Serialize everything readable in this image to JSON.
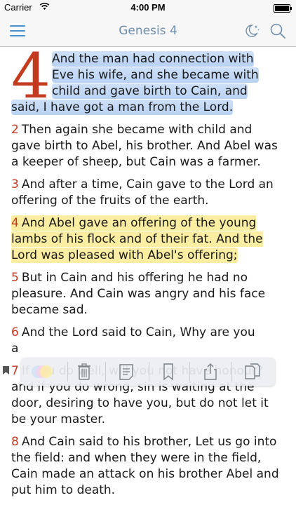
{
  "status_bar": {
    "carrier": "Carrier",
    "time": "4:00 PM"
  },
  "nav": {
    "title": "Genesis 4",
    "menu_icon": "hamburger-menu-icon",
    "night_icon": "moon-stars-icon",
    "search_icon": "search-icon",
    "accent_color": "#4a8fc7"
  },
  "chapter": {
    "drop_cap": "4",
    "verse_number_color": "#c33a1f",
    "highlight_blue": "#cfe0f7",
    "highlight_yellow": "#fbeea2",
    "verses": [
      {
        "num": "",
        "text_lines": [
          "And the man had connection with",
          "Eve his wife, and she became with",
          "child and gave birth to Cain, and",
          "said, I have got a man from the Lord."
        ],
        "highlight": "blue"
      },
      {
        "num": "2",
        "text": "Then again she became with child and gave birth to Abel, his brother. And Abel was a keeper of sheep, but Cain was a farmer.",
        "highlight": "none"
      },
      {
        "num": "3",
        "text": "And after a time, Cain gave to the Lord an offering of the fruits of the earth.",
        "highlight": "none"
      },
      {
        "num": "4",
        "text": "And Abel gave an offering of the young lambs of his flock and of their fat. And the Lord was pleased with Abel's offering;",
        "highlight": "yellow"
      },
      {
        "num": "5",
        "text": "But in Cain and his offering he had no pleasure. And Cain was angry and his face became sad.",
        "highlight": "none"
      },
      {
        "num": "6",
        "text_visible_line": "And the Lord said to Cain, Why are you",
        "text_partial": "a",
        "highlight": "none"
      },
      {
        "num": "7",
        "text": "If you do well, will you not have honour? and if you do wrong, sin is waiting at the door, desiring to have you, but do not let it be your master.",
        "highlight": "none",
        "bookmarked": true
      },
      {
        "num": "8",
        "text": "And Cain said to his brother, Let us go into the field: and when they were in the field, Cain made an attack on his brother Abel and put him to death.",
        "highlight": "none"
      }
    ]
  },
  "toolbar": {
    "items": [
      {
        "name": "highlight-color-icon"
      },
      {
        "name": "trash-icon"
      },
      {
        "name": "note-icon"
      },
      {
        "name": "bookmark-icon"
      },
      {
        "name": "share-icon"
      },
      {
        "name": "copy-icon"
      }
    ]
  }
}
